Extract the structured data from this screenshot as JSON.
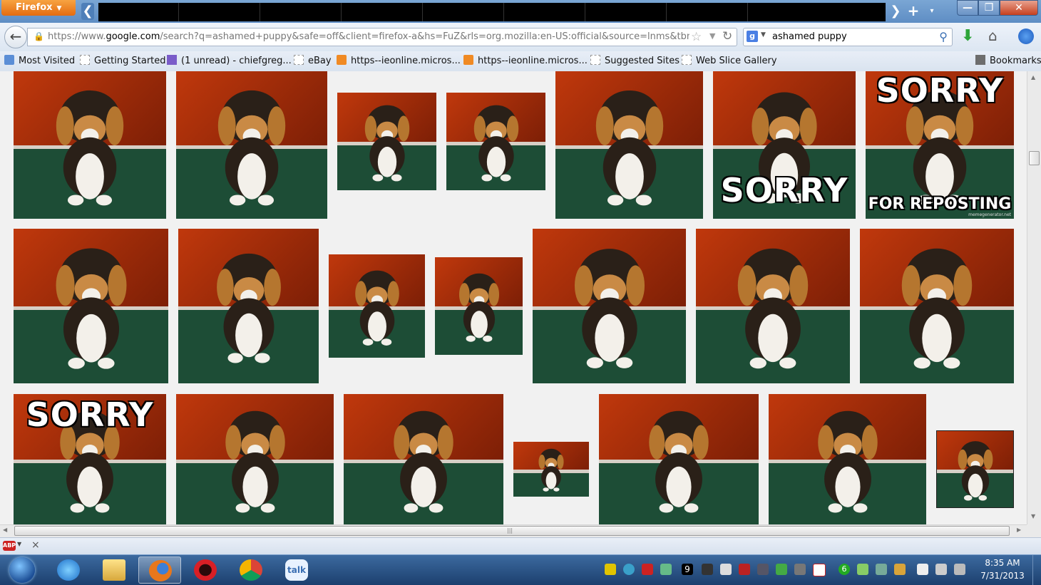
{
  "window": {
    "app_button": "Firefox",
    "controls": {
      "minimize": "—",
      "maximize": "❒",
      "close": "✕"
    }
  },
  "tabs": {
    "scroll_left": "❮",
    "scroll_right": "❯",
    "new_tab": "+",
    "list_all": "▾"
  },
  "nav": {
    "back": "←",
    "url_prefix": "https://www.",
    "url_domain": "google.com",
    "url_rest": "/search?q=ashamed+puppy&safe=off&client=firefox-a&hs=FuZ&rls=org.mozilla:en-US:official&source=lnms&tbm=isch&sa",
    "search_engine_icon": "g-icon",
    "search_value": "ashamed puppy"
  },
  "bookmarks": [
    {
      "label": "Most Visited",
      "icon": "most-visited-icon"
    },
    {
      "label": "Getting Started",
      "icon": "page-icon"
    },
    {
      "label": "(1 unread) - chiefgreg...",
      "icon": "mail-icon"
    },
    {
      "label": "eBay",
      "icon": "page-icon"
    },
    {
      "label": "https--ieonline.micros...",
      "icon": "bulb-icon"
    },
    {
      "label": "https--ieonline.micros...",
      "icon": "bulb-icon"
    },
    {
      "label": "Suggested Sites",
      "icon": "page-icon"
    },
    {
      "label": "Web Slice Gallery",
      "icon": "page-icon"
    }
  ],
  "bookmarks_menu": "Bookmarks",
  "image_results": {
    "captions": {
      "sorry": "SORRY",
      "for_reposting": "FOR REPOSTING",
      "watermark": "memegenerator.net"
    }
  },
  "taskbar": {
    "apps": [
      "Internet Explorer",
      "Windows Explorer",
      "Firefox",
      "Opera",
      "Google Chrome",
      "Google Talk"
    ],
    "talk_label": "talk",
    "tray_badge": "9",
    "tray_badge2": "6",
    "time": "8:35 AM",
    "date": "7/31/2013"
  },
  "addon_bar": {
    "abp": "ABP",
    "close": "×"
  },
  "colors": {
    "firefox_orange": "#e8771c",
    "taskbar_blue": "#1c3f6e",
    "wall_red": "#b5340b",
    "rug_green": "#1d4d36"
  }
}
